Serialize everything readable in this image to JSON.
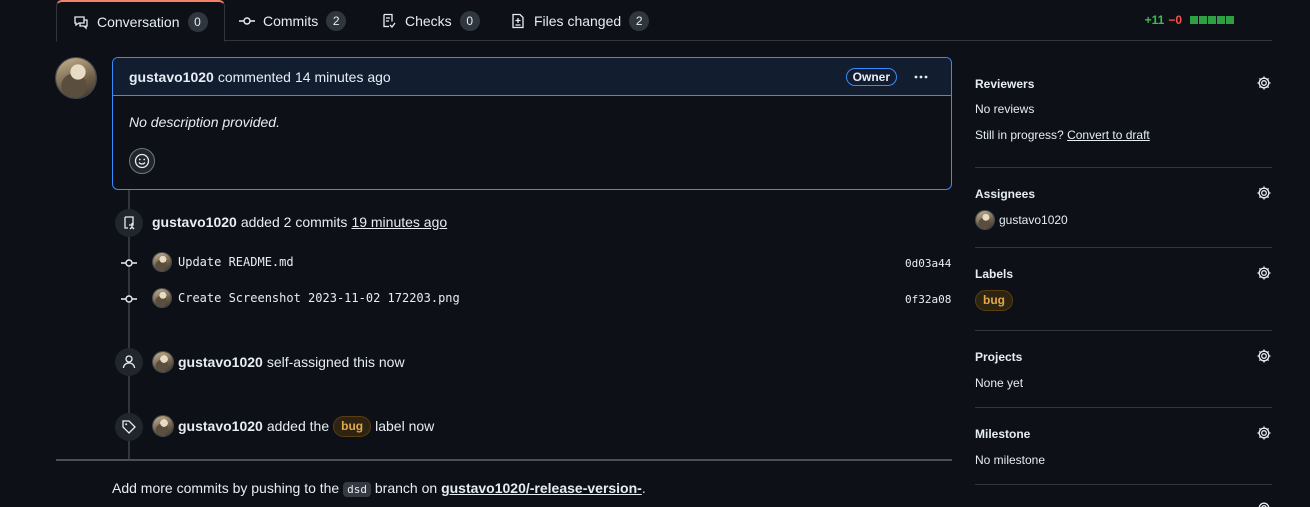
{
  "tabs": [
    {
      "label": "Conversation",
      "count": "0"
    },
    {
      "label": "Commits",
      "count": "2"
    },
    {
      "label": "Checks",
      "count": "0"
    },
    {
      "label": "Files changed",
      "count": "2"
    }
  ],
  "diffstat": {
    "additions": "+11",
    "deletions": "−0"
  },
  "comment": {
    "author": "gustavo1020",
    "action": "commented",
    "time": "14 minutes ago",
    "role": "Owner",
    "body": "No description provided."
  },
  "timeline": {
    "commits_event": {
      "author": "gustavo1020",
      "text": "added 2 commits",
      "time": "19 minutes ago"
    },
    "commits": [
      {
        "message": "Update README.md",
        "sha": "0d03a44"
      },
      {
        "message": "Create Screenshot 2023-11-02 172203.png",
        "sha": "0f32a08"
      }
    ],
    "assign_event": {
      "author": "gustavo1020",
      "text": "self-assigned this now"
    },
    "label_event": {
      "author": "gustavo1020",
      "pre": "added the",
      "label": "bug",
      "post": "label now"
    }
  },
  "footer": {
    "pre": "Add more commits by pushing to the",
    "branch": "dsd",
    "mid": "branch on",
    "repo": "gustavo1020/-release-version-",
    "post": "."
  },
  "sidebar": {
    "reviewers": {
      "title": "Reviewers",
      "value": "No reviews",
      "progress_text": "Still in progress?",
      "convert_link": "Convert to draft"
    },
    "assignees": {
      "title": "Assignees",
      "value": "gustavo1020"
    },
    "labels": {
      "title": "Labels",
      "value": "bug"
    },
    "projects": {
      "title": "Projects",
      "value": "None yet"
    },
    "milestone": {
      "title": "Milestone",
      "value": "No milestone"
    }
  },
  "colors": {
    "accent_border": "#388bfd",
    "label_bug": "#e3a84b",
    "add": "#3fb950",
    "del": "#f85149"
  }
}
